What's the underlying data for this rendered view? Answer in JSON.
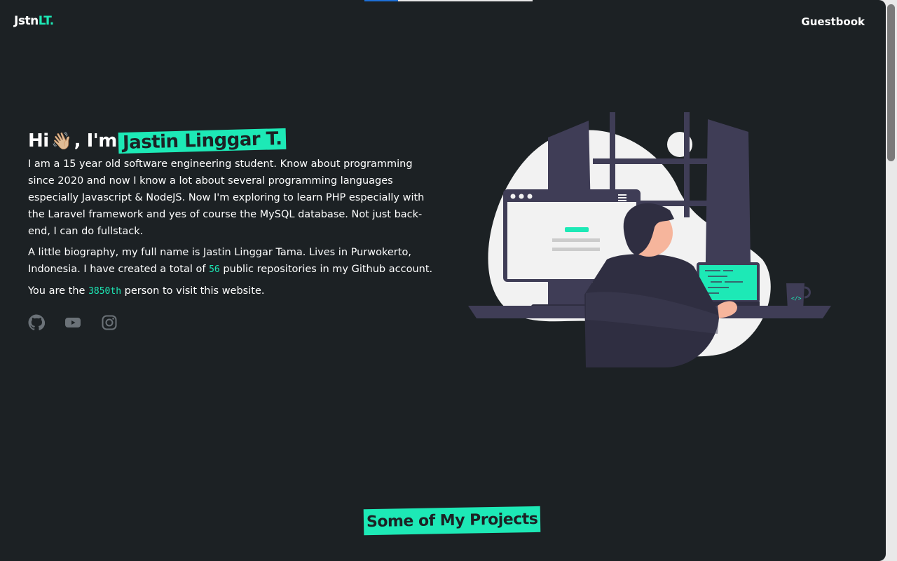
{
  "header": {
    "logo_main": "Jstn",
    "logo_accent": "LT.",
    "nav_guestbook": "Guestbook",
    "progress_fraction": 0.2
  },
  "hero": {
    "greeting_prefix": "Hi",
    "wave_emoji": "👋🏼",
    "greeting_mid": ", I'm",
    "name_highlight": "Jastin Linggar T.",
    "bio_paragraph": "I am a 15 year old software engineering student. Know about programming since 2020 and now I know a lot about several programming languages especially Javascript & NodeJS. Now I'm exploring to learn PHP especially with the Laravel framework and yes of course the MySQL database. Not just back-end, I can do fullstack.",
    "biography_prefix": "A little biography, my full name is Jastin Linggar Tama. Lives in Purwokerto, Indonesia. I have created a total of",
    "repo_count": "56",
    "biography_suffix": "public repositories in my Github account.",
    "visitor_prefix": "You are the",
    "visitor_number": "3850th",
    "visitor_suffix": "person to visit this website."
  },
  "socials": [
    {
      "icon": "github-icon"
    },
    {
      "icon": "youtube-icon"
    },
    {
      "icon": "instagram-icon"
    }
  ],
  "section": {
    "projects_title": "Some of My Projects"
  },
  "colors": {
    "accent": "#1de9b6",
    "background": "#1c2124",
    "icon_muted": "#6b7278"
  }
}
